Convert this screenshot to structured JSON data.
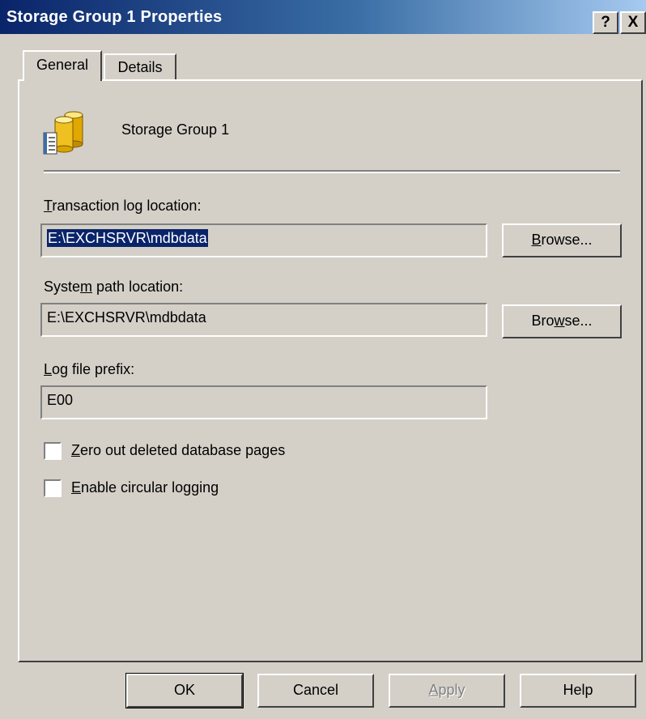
{
  "window": {
    "title": "Storage Group 1 Properties",
    "help_button": "?",
    "close_button": "X"
  },
  "tabs": [
    {
      "label": "General",
      "active": true
    },
    {
      "label": "Details",
      "active": false
    }
  ],
  "general": {
    "icon": "storage-group-icon",
    "name": "Storage Group 1",
    "transaction_log": {
      "label_pre": "",
      "label_accel": "T",
      "label_post": "ransaction log location:",
      "value": "E:\\EXCHSRVR\\mdbdata",
      "browse_pre": "",
      "browse_accel": "B",
      "browse_post": "rowse..."
    },
    "system_path": {
      "label_pre": "Syste",
      "label_accel": "m",
      "label_post": " path location:",
      "value": "E:\\EXCHSRVR\\mdbdata",
      "browse_pre": "Bro",
      "browse_accel": "w",
      "browse_post": "se..."
    },
    "log_prefix": {
      "label_pre": "",
      "label_accel": "L",
      "label_post": "og file prefix:",
      "value": "E00"
    },
    "checkboxes": [
      {
        "pre": "",
        "accel": "Z",
        "post": "ero out deleted database pages",
        "checked": false
      },
      {
        "pre": "",
        "accel": "E",
        "post": "nable circular logging",
        "checked": false
      }
    ]
  },
  "buttons": {
    "ok": "OK",
    "cancel": "Cancel",
    "apply_pre": "",
    "apply_accel": "A",
    "apply_post": "pply",
    "help": "Help"
  }
}
